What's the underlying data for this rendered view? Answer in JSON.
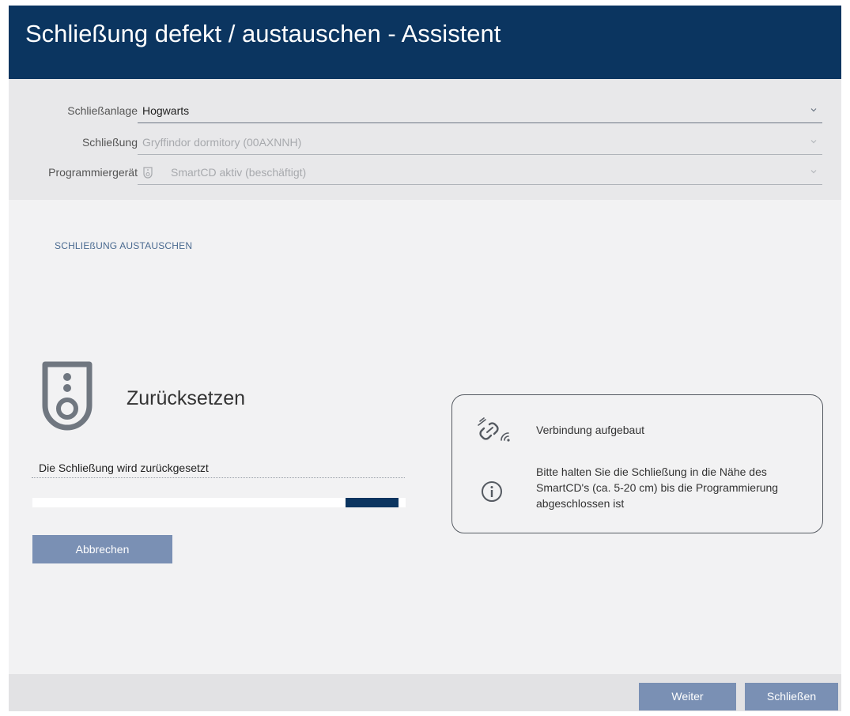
{
  "window": {
    "title": "Schließung defekt / austauschen - Assistent"
  },
  "form": {
    "rows": [
      {
        "label": "Schließanlage",
        "value": "Hogwarts",
        "enabled": true
      },
      {
        "label": "Schließung",
        "value": "Gryffindor dormitory (00AXNNH)",
        "enabled": false
      },
      {
        "label": "Programmiergerät",
        "value": "SmartCD aktiv (beschäftigt)",
        "enabled": false,
        "icon": "smartcd-shield-icon"
      }
    ]
  },
  "section": {
    "heading": "SCHLIEßUNG AUSTAUSCHEN"
  },
  "step": {
    "icon": "lock-cylinder-icon",
    "title": "Zurücksetzen",
    "status": "Die Schließung wird zurückgesetzt",
    "progress_percent": 14
  },
  "actions": {
    "cancel_label": "Abbrechen",
    "next_label": "Weiter",
    "close_label": "Schließen"
  },
  "info": {
    "connection_icon": "connection-link-icon",
    "connection_text": "Verbindung aufgebaut",
    "hint_icon": "info-circle-icon",
    "hint_text": "Bitte halten Sie die Schließung in die Nähe des SmartCD's (ca. 5-20 cm) bis die Programmierung abgeschlossen ist"
  },
  "colors": {
    "title_bar": "#0b3560",
    "button": "#7a90b4",
    "progress": "#0b3560"
  }
}
